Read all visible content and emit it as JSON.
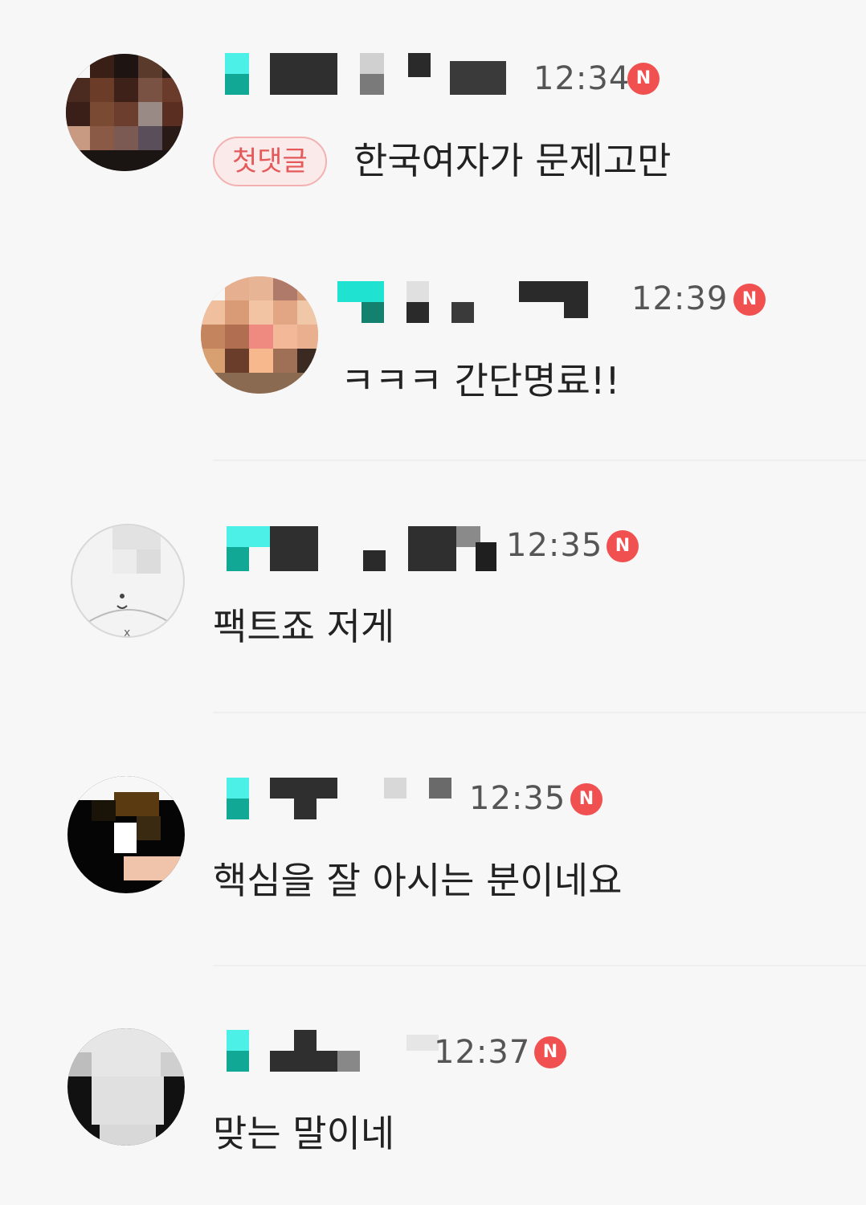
{
  "comments": [
    {
      "time": "12:34",
      "badge": "N",
      "first_tag": "첫댓글",
      "text": "한국여자가 문제고만"
    },
    {
      "time": "12:39",
      "badge": "N",
      "text": "ㅋㅋㅋ 간단명료!!"
    },
    {
      "time": "12:35",
      "badge": "N",
      "text": "팩트죠 저게"
    },
    {
      "time": "12:35",
      "badge": "N",
      "text": "핵심을 잘 아시는 분이네요"
    },
    {
      "time": "12:37",
      "badge": "N",
      "text": "맞는 말이네"
    }
  ]
}
